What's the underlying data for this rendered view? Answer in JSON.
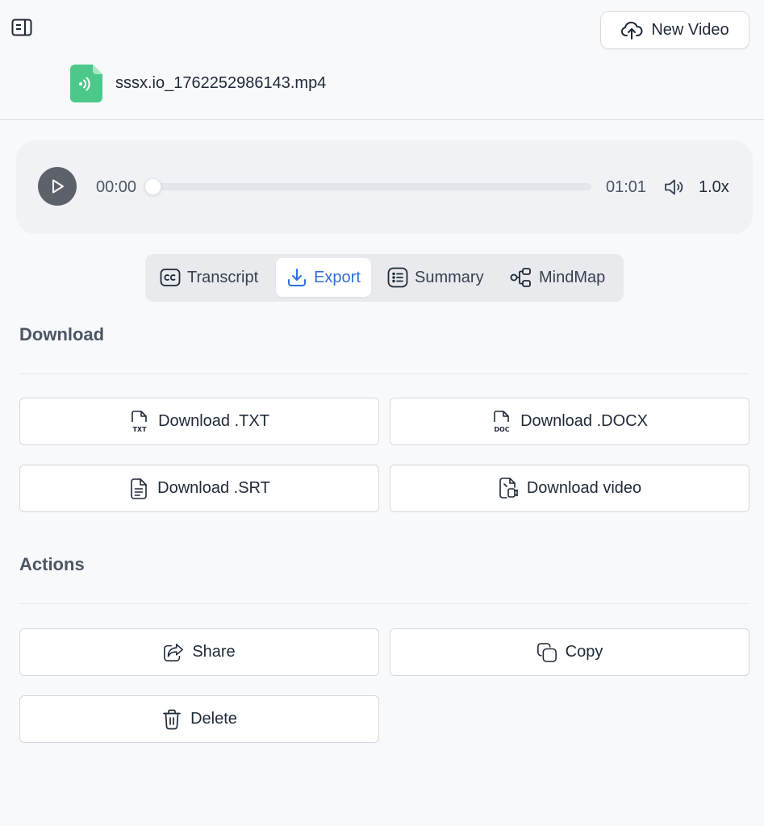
{
  "header": {
    "sidebar_toggle_icon": "sidebar-toggle-icon",
    "new_video_label": "New Video",
    "new_video_icon": "cloud-upload-icon"
  },
  "file": {
    "name": "sssx.io_1762252986143.mp4",
    "icon": "audio-file-icon",
    "icon_color": "#4cc98a"
  },
  "player": {
    "current_time": "00:00",
    "total_time": "01:01",
    "progress": 0,
    "speed": "1.0x",
    "play_icon": "play-icon",
    "volume_icon": "volume-icon"
  },
  "tabs": [
    {
      "label": "Transcript",
      "icon": "closed-caption-icon",
      "active": false
    },
    {
      "label": "Export",
      "icon": "download-icon",
      "active": true
    },
    {
      "label": "Summary",
      "icon": "list-icon",
      "active": false
    },
    {
      "label": "MindMap",
      "icon": "mindmap-icon",
      "active": false
    }
  ],
  "download": {
    "title": "Download",
    "buttons": [
      {
        "label": "Download .TXT",
        "icon": "txt-file-icon"
      },
      {
        "label": "Download .DOCX",
        "icon": "doc-file-icon"
      },
      {
        "label": "Download .SRT",
        "icon": "srt-file-icon"
      },
      {
        "label": "Download video",
        "icon": "video-file-icon"
      }
    ]
  },
  "actions": {
    "title": "Actions",
    "buttons": [
      {
        "label": "Share",
        "icon": "share-icon"
      },
      {
        "label": "Copy",
        "icon": "copy-icon"
      },
      {
        "label": "Delete",
        "icon": "trash-icon"
      }
    ]
  },
  "colors": {
    "accent": "#2f6fdc",
    "play_button": "#5d6169",
    "background": "#f8f9fb"
  }
}
